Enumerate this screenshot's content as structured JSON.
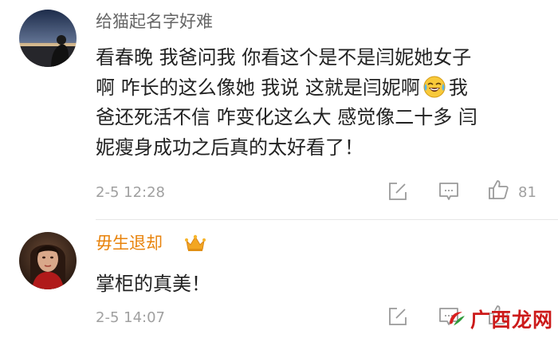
{
  "comments": [
    {
      "username": "给猫起名字好难",
      "lines": [
        "看春晚 我爸问我 你看这个是不是闫妮她女子",
        "啊 咋长的这么像她 我说 这就是闫妮啊",
        "爸还死活不信 咋变化这么大 感觉像二十多 闫",
        "妮瘦身成功之后真的太好看了！"
      ],
      "line2_after_emoji": "我",
      "emoji": "crying-laughing-emoji",
      "timestamp": "2-5 12:28",
      "like_count": "81"
    },
    {
      "username": "毋生退却",
      "badge": "crown-icon",
      "text": "掌柜的真美！",
      "timestamp": "2-5 14:07"
    }
  ],
  "watermark": {
    "text": "广西龙网"
  },
  "colors": {
    "username_default": "#666666",
    "username_vip": "#e8830c",
    "body_text": "#222222",
    "meta_text": "#a0a0a0",
    "watermark": "#cc1a1a"
  },
  "icons": {
    "edit": "edit-square-icon",
    "comment": "comment-bubble-icon",
    "like": "thumbs-up-icon"
  }
}
